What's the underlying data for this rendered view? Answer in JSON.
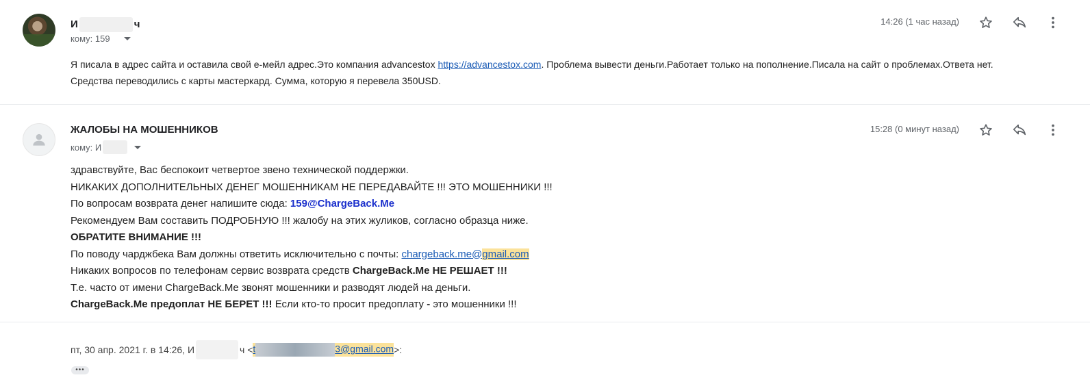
{
  "message1": {
    "sender_start": "И",
    "sender_end": "ч",
    "recipient_prefix": "кому:",
    "recipient": "159",
    "time": "14:26 (1 час назад)",
    "icons": [
      "star-icon",
      "reply-icon",
      "more-vert-icon"
    ],
    "body_part1": "Я писала в адрес сайта и оставила свой е-мейл адрес.Это компания advancestox ",
    "body_link": "https://advancestox.com",
    "body_part2": ". Проблема вывести деньги.Работает только на пополнение.Писала на сайт о проблемах.Ответа нет. Средства переводились с карты мастеркард.  Сумма, которую я перевела 350USD."
  },
  "message2": {
    "sender": "ЖАЛОБЫ НА МОШЕННИКОВ",
    "recipient_prefix": "кому:",
    "recipient": "И",
    "time": "15:28 (0 минут назад)",
    "icons": [
      "star-icon",
      "reply-icon",
      "more-vert-icon"
    ],
    "lines": {
      "l1": "здравствуйте, Вас беспокоит четвертое звено технической поддержки.",
      "l2": "НИКАКИХ ДОПОЛНИТЕЛЬНЫХ ДЕНЕГ МОШЕННИКАМ НЕ ПЕРЕДАВАЙТЕ !!! ЭТО МОШЕННИКИ !!!",
      "l3_text": "По вопросам возврата денег напишите сюда: ",
      "l3_email": "159@ChargeBack.Me",
      "l4": "Рекомендуем Вам составить ПОДРОБНУЮ !!! жалобу на этих жуликов, согласно образца ниже.",
      "l5": "ОБРАТИТЕ ВНИМАНИЕ !!!",
      "l6_text": "По поводу чарджбека Вам должны ответить исключительно с почты: ",
      "l6_link_a": "chargeback.me@",
      "l6_link_b": "gmail.com",
      "l7_text": "Никаких вопросов по телефонам сервис возврата средств ",
      "l7_bold": "ChargeBack.Me НЕ РЕШАЕТ !!!",
      "l8": "Т.е. часто от имени ChargeBack.Me звонят мошенники и разводят людей на деньги.",
      "l9_bold": "ChargeBack.Me предоплат НЕ БЕРЕТ !!!",
      "l9_text": " Если кто-то просит предоплату ",
      "l9_dash": "-",
      "l9_end": " это мошенники !!!"
    }
  },
  "quote": {
    "prefix": "пт, 30 апр. 2021 г. в 14:26, И",
    "mid": "ч <",
    "email_start": "t",
    "email_end": "3@gmail.com",
    "suffix": ">:"
  },
  "show_trimmed": "•••"
}
